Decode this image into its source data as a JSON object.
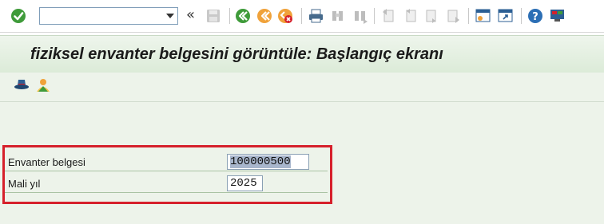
{
  "toolbar": {
    "command_field_value": "",
    "left_arrows": "«"
  },
  "title": {
    "text": "fiziksel envanter belgesini görüntüle: Başlangıç ekranı"
  },
  "form": {
    "document_label": "Envanter belgesi",
    "document_value": "100000500",
    "year_label": "Mali yıl",
    "year_value": "2025"
  },
  "colors": {
    "highlight_box": "#d6202b",
    "title_bar_bg": "#dcebd8",
    "work_bg": "#edf3ea"
  }
}
